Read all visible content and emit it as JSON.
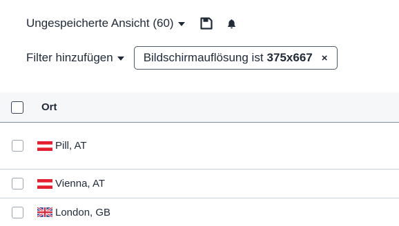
{
  "view": {
    "name": "Ungespeicherte Ansicht (60)",
    "save_icon": "save-icon",
    "bell_icon": "bell-icon"
  },
  "filter": {
    "add_label": "Filter hinzufügen",
    "chip_prefix": "Bildschirmauflösung ist",
    "chip_value": "375x667",
    "chip_close": "×"
  },
  "table": {
    "header_label": "Ort",
    "rows": [
      {
        "label": "Pill, AT",
        "flag": "austria-flag-icon"
      },
      {
        "label": "Vienna, AT",
        "flag": "austria-flag-icon"
      },
      {
        "label": "London, GB",
        "flag": "uk-flag-icon"
      }
    ]
  },
  "colors": {
    "text": "#1f2937",
    "header_bg": "#f6f7f8",
    "austria_red": "#e4202e",
    "uk_blue": "#3a4f9c",
    "uk_red": "#d22b3c"
  }
}
